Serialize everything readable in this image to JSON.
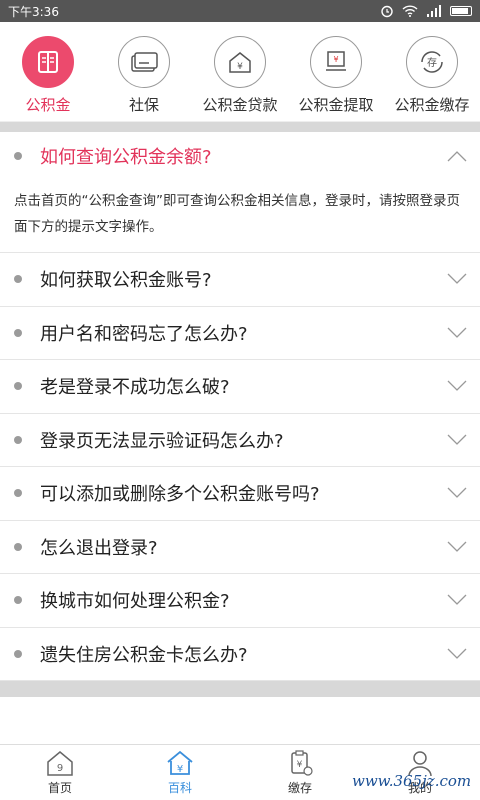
{
  "status_bar": {
    "time": "下午3:36"
  },
  "tabs": [
    {
      "label": "公积金",
      "icon": "book-icon",
      "active": true
    },
    {
      "label": "社保",
      "icon": "card-icon",
      "active": false
    },
    {
      "label": "公积金贷款",
      "icon": "house-yen-icon",
      "active": false
    },
    {
      "label": "公积金提取",
      "icon": "withdraw-yen-icon",
      "active": false
    },
    {
      "label": "公积金缴存",
      "icon": "deposit-icon",
      "active": false
    }
  ],
  "faq": {
    "expanded": {
      "question": "如何查询公积金余额?",
      "answer": "点击首页的“公积金查询”即可查询公积金相关信息，登录时，请按照登录页面下方的提示文字操作。"
    },
    "items": [
      "如何获取公积金账号?",
      "用户名和密码忘了怎么办?",
      "老是登录不成功怎么破?",
      "登录页无法显示验证码怎么办?",
      "可以添加或删除多个公积金账号吗?",
      "怎么退出登录?",
      "换城市如何处理公积金?",
      "遗失住房公积金卡怎么办?"
    ]
  },
  "bottom_nav": [
    {
      "label": "首页",
      "icon": "home-icon",
      "active": false
    },
    {
      "label": "百科",
      "icon": "encyclopedia-icon",
      "active": true
    },
    {
      "label": "缴存",
      "icon": "deposit-clipboard-icon",
      "active": false
    },
    {
      "label": "我的",
      "icon": "user-icon",
      "active": false
    }
  ],
  "watermark": "www.365jz.com",
  "colors": {
    "accent": "#e2335a",
    "nav_active": "#3a8fdc",
    "status_bar": "#555555"
  }
}
